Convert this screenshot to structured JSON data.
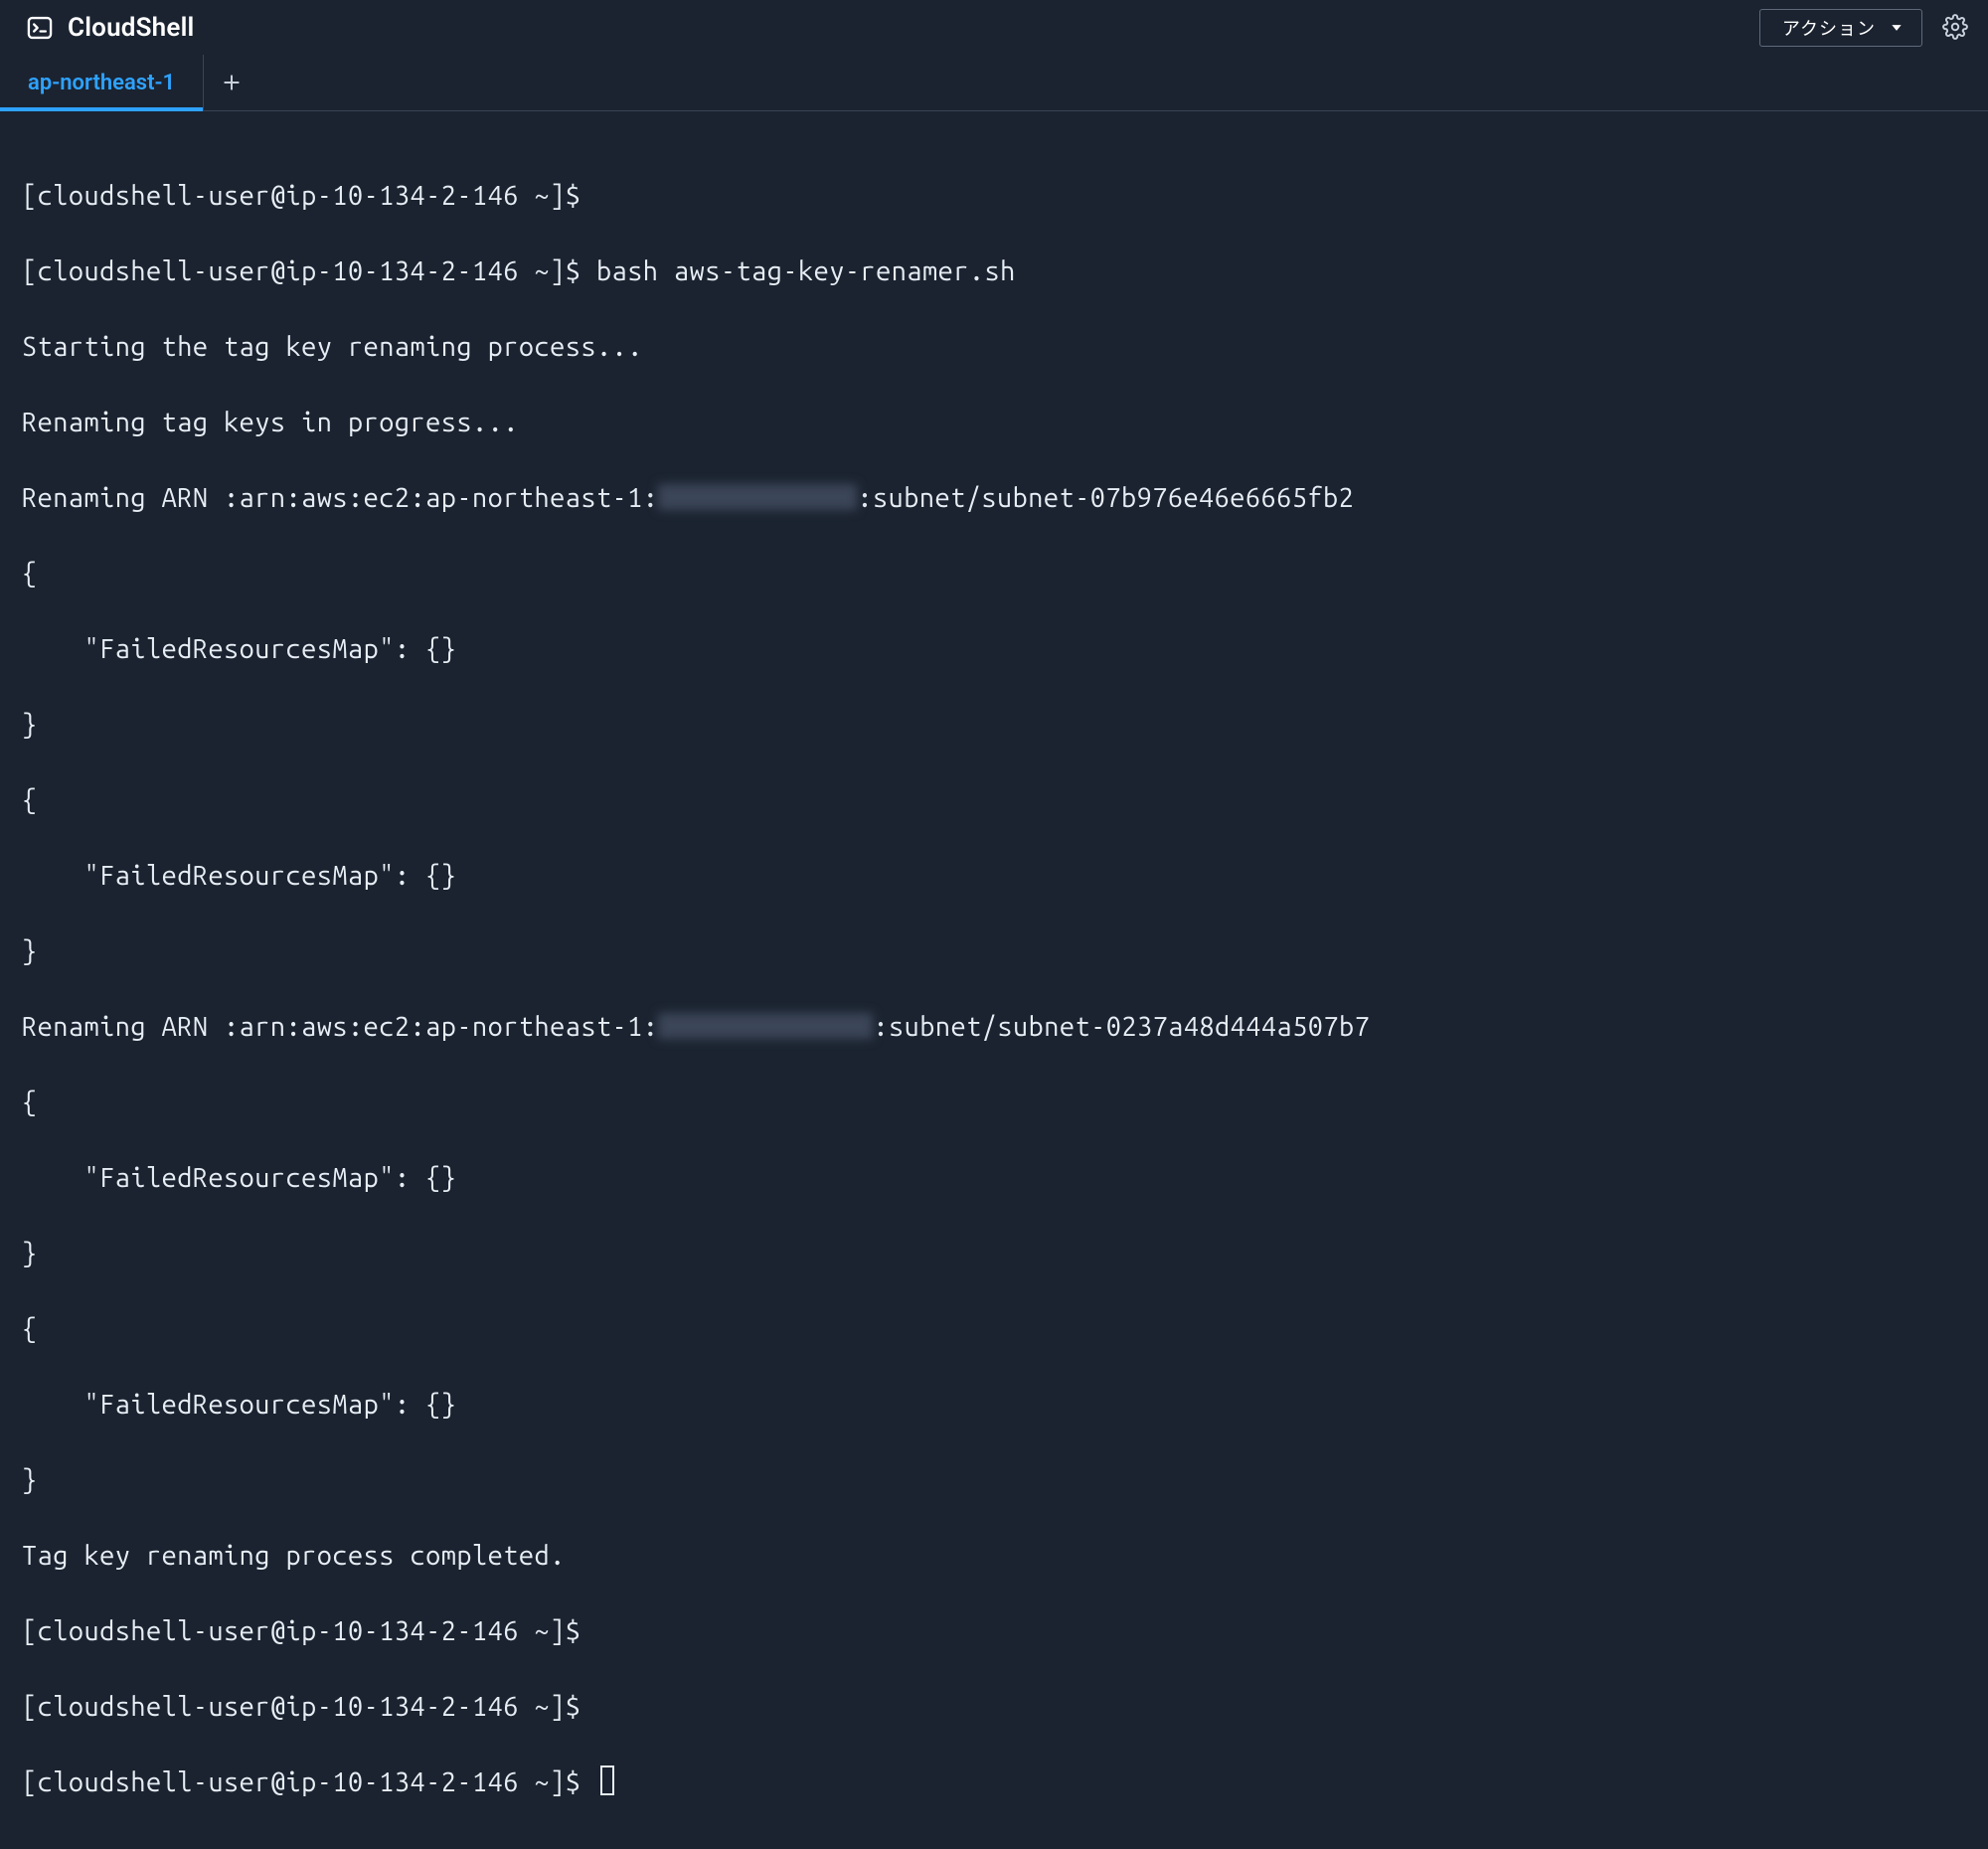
{
  "header": {
    "title": "CloudShell",
    "actions_label": "アクション"
  },
  "tabs": {
    "items": [
      {
        "label": "ap-northeast-1",
        "active": true
      }
    ]
  },
  "terminal": {
    "prompt": "[cloudshell-user@ip-10-134-2-146 ~]$",
    "lines": {
      "l0_cmd": " ",
      "l1_cmd": " bash aws-tag-key-renamer.sh",
      "l2": "Starting the tag key renaming process...",
      "l3": "Renaming tag keys in progress...",
      "l4a": "Renaming ARN :arn:aws:ec2:ap-northeast-1:",
      "l4b": ":subnet/subnet-07b976e46e6665fb2",
      "l5": "{",
      "l6": "    \"FailedResourcesMap\": {}",
      "l7": "}",
      "l8": "{",
      "l9": "    \"FailedResourcesMap\": {}",
      "l10": "}",
      "l11a": "Renaming ARN :arn:aws:ec2:ap-northeast-1:",
      "l11b": ":subnet/subnet-0237a48d444a507b7",
      "l12": "{",
      "l13": "    \"FailedResourcesMap\": {}",
      "l14": "}",
      "l15": "{",
      "l16": "    \"FailedResourcesMap\": {}",
      "l17": "}",
      "l18": "Tag key renaming process completed.",
      "l19_cmd": " ",
      "l20_cmd": " ",
      "l21_cmd": " "
    }
  }
}
